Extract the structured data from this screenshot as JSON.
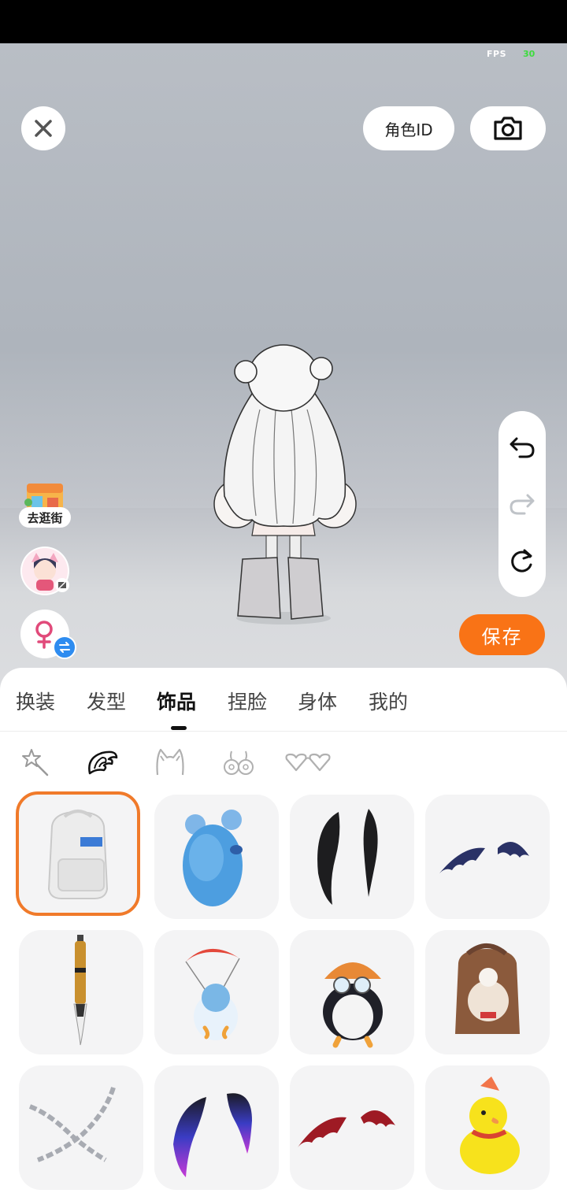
{
  "status": {
    "fps_label": "FPS",
    "fps_value": "30"
  },
  "header": {
    "role_id_label": "角色ID"
  },
  "side": {
    "shop_label": "去逛街"
  },
  "actions": {
    "save_label": "保存"
  },
  "tabs": [
    {
      "label": "换装",
      "active": false
    },
    {
      "label": "发型",
      "active": false
    },
    {
      "label": "饰品",
      "active": true
    },
    {
      "label": "捏脸",
      "active": false
    },
    {
      "label": "身体",
      "active": false
    },
    {
      "label": "我的",
      "active": false
    }
  ],
  "subcategories": [
    "star-wand-icon",
    "wing-icon",
    "headband-icon",
    "earring-icon",
    "glasses-icon"
  ],
  "items": [
    {
      "name": "white-backpack",
      "selected": true
    },
    {
      "name": "blue-mouse-backpack"
    },
    {
      "name": "black-wings"
    },
    {
      "name": "bat-wings-dark"
    },
    {
      "name": "calligraphy-brush"
    },
    {
      "name": "penguin-parachute"
    },
    {
      "name": "penguin-aviator"
    },
    {
      "name": "bear-backpack"
    },
    {
      "name": "silver-chains"
    },
    {
      "name": "purple-gradient-wings"
    },
    {
      "name": "bat-wings-red"
    },
    {
      "name": "yellow-duck"
    }
  ],
  "colors": {
    "accent": "#f97316",
    "selected_border": "#f07a2a"
  }
}
